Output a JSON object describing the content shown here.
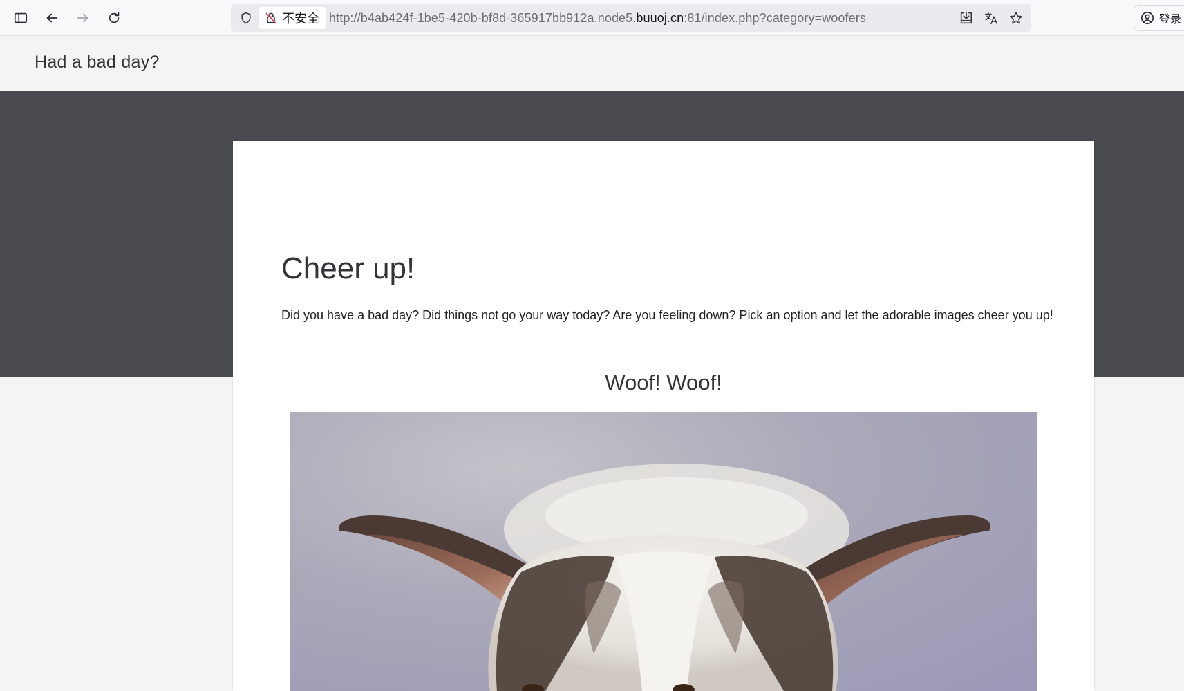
{
  "browser": {
    "security_label": "不安全",
    "url": {
      "prefix": "http://b4ab424f-1be5-420b-bf8d-365917bb912a.node5.",
      "host": "buuoj.cn",
      "suffix": ":81/index.php?category=woofers"
    },
    "account_label": "登录",
    "toolbar_icons": [
      "sidebar-icon",
      "back-arrow-icon",
      "forward-arrow-icon",
      "reload-icon",
      "shield-icon",
      "insecure-lock-icon",
      "download-icon",
      "translate-icon",
      "star-icon",
      "account-icon"
    ]
  },
  "page": {
    "site_title": "Had a bad day?",
    "card": {
      "title": "Cheer up!",
      "text": "Did you have a bad day? Did things not go your way today? Are you feeling down? Pick an option and let the adorable images cheer you up!",
      "section_title": "Woof! Woof!"
    }
  },
  "colors": {
    "hero_band": "#484a4f",
    "page_background": "#f4f4f4",
    "card_background": "#ffffff",
    "text": "#333338"
  }
}
